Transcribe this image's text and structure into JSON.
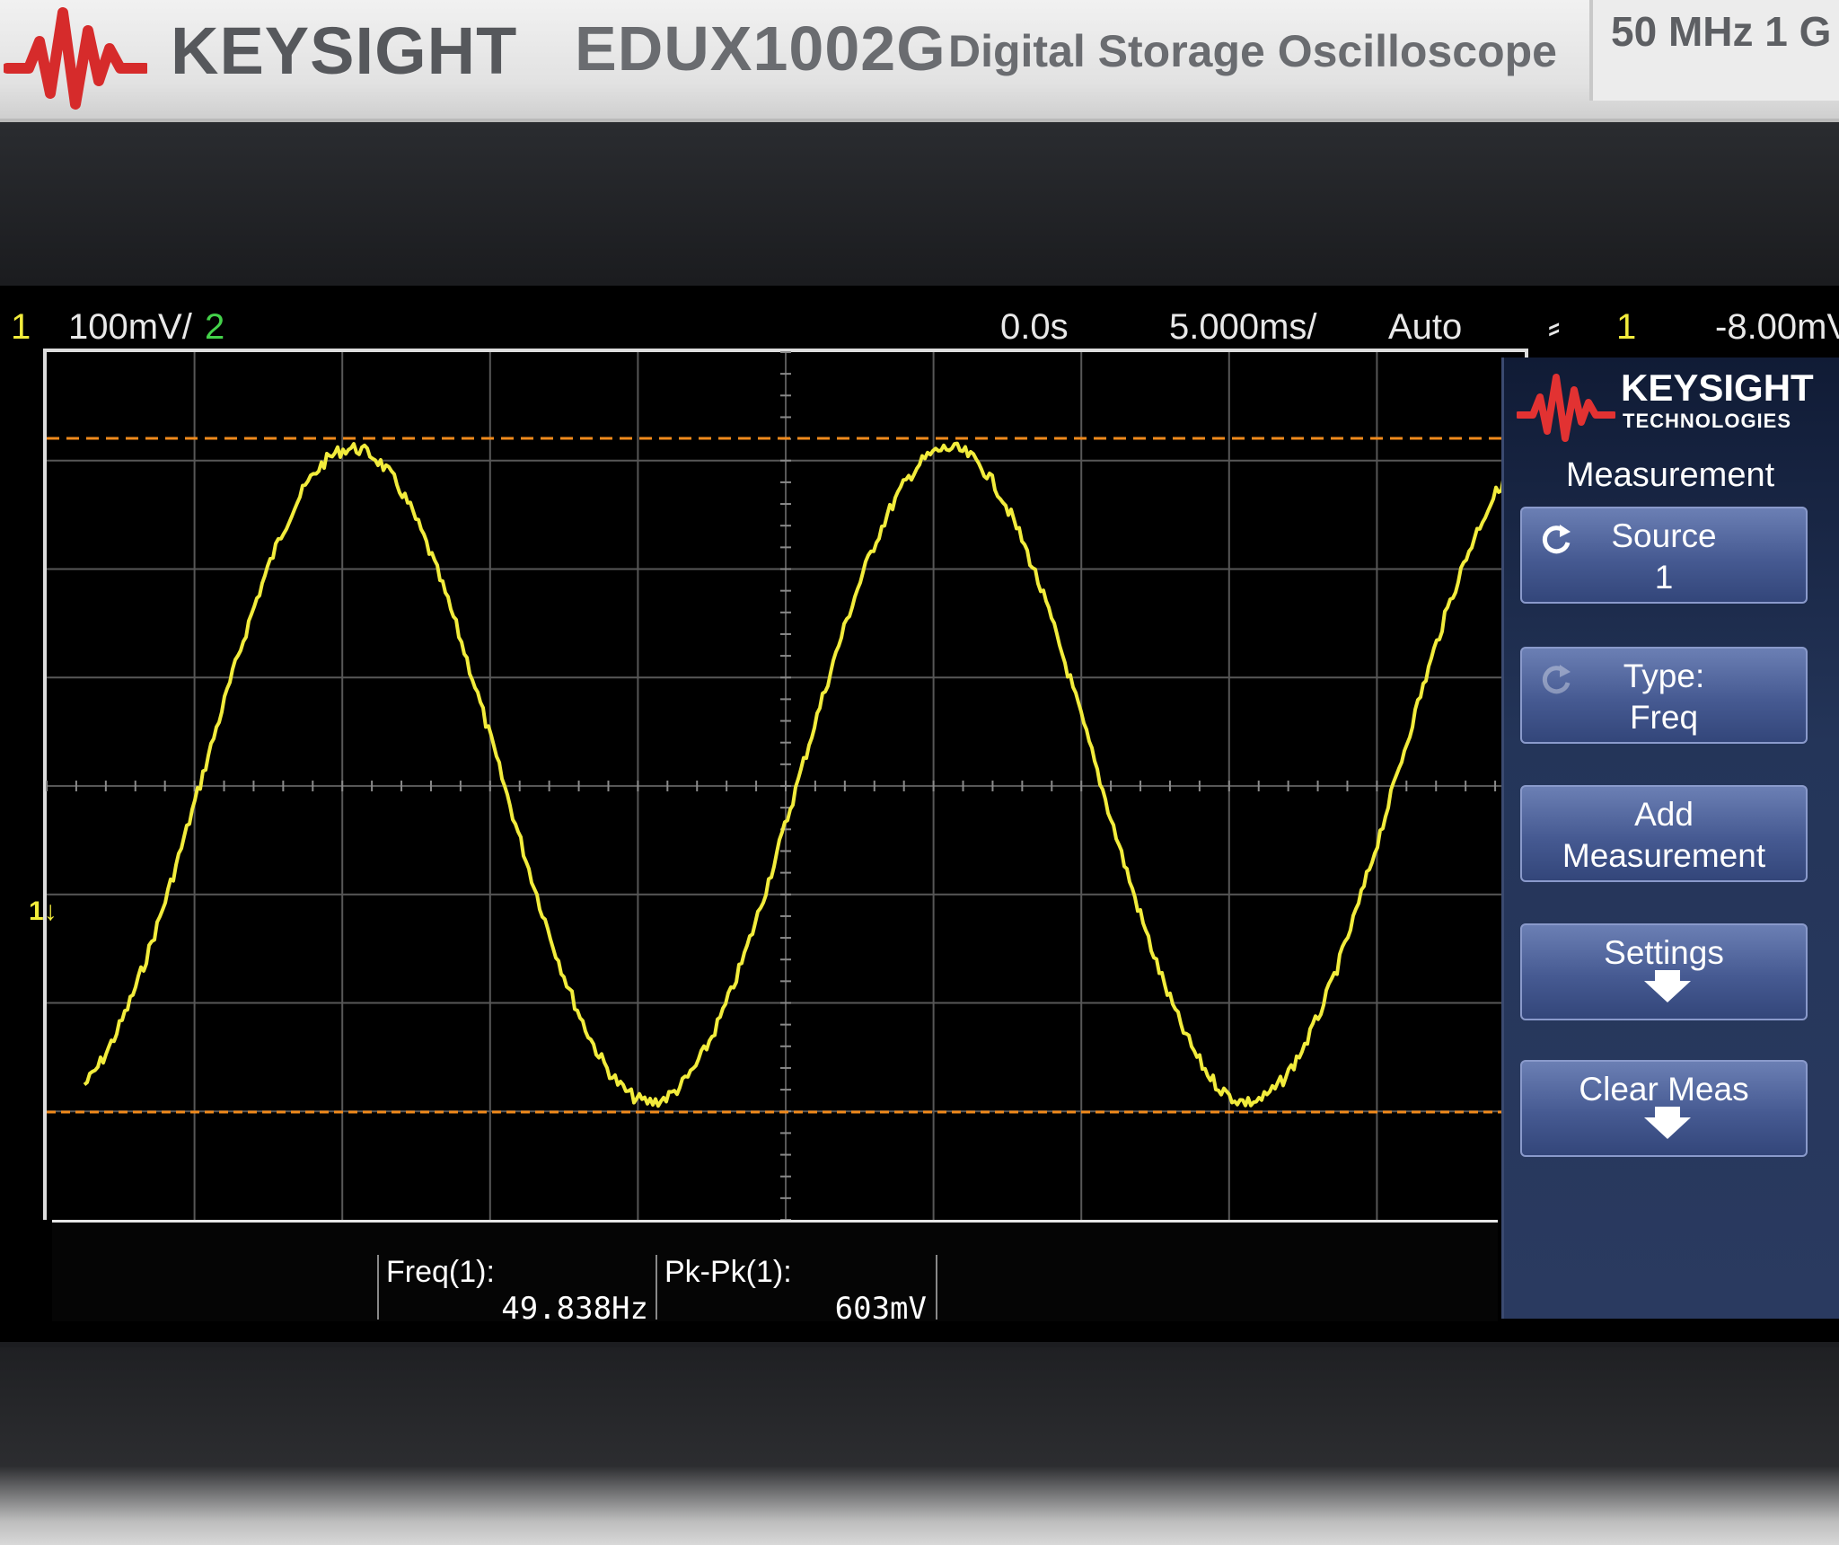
{
  "front_panel": {
    "brand": "KEYSIGHT",
    "model": "EDUX1002G",
    "description": "Digital Storage Oscilloscope",
    "spec": "50 MHz 1 G"
  },
  "status_bar": {
    "ch1_number": "1",
    "ch1_scale": "100mV/",
    "ch2_number": "2",
    "time_delay": "0.0s",
    "time_scale": "5.000ms/",
    "trigger_mode": "Auto",
    "trigger_source": "1",
    "trigger_level": "-8.00mV"
  },
  "menu": {
    "logo_name": "KEYSIGHT",
    "logo_sub": "TECHNOLOGIES",
    "title": "Measurement",
    "source": {
      "line1": "Source",
      "line2": "1"
    },
    "type": {
      "line1": "Type:",
      "line2": "Freq"
    },
    "add": {
      "line1": "Add",
      "line2": "Measurement"
    },
    "settings": {
      "line1": "Settings"
    },
    "clear": {
      "line1": "Clear Meas"
    }
  },
  "measurements": [
    {
      "label": "Freq(1):",
      "value": "49.838Hz"
    },
    {
      "label": "Pk-Pk(1):",
      "value": "603mV"
    }
  ],
  "colors": {
    "channel1": "#f2ec3c",
    "channel2": "#44d24a",
    "cursor": "#f08a1c",
    "grid": "#5a5a5a",
    "menu_bg": "#243559"
  }
}
